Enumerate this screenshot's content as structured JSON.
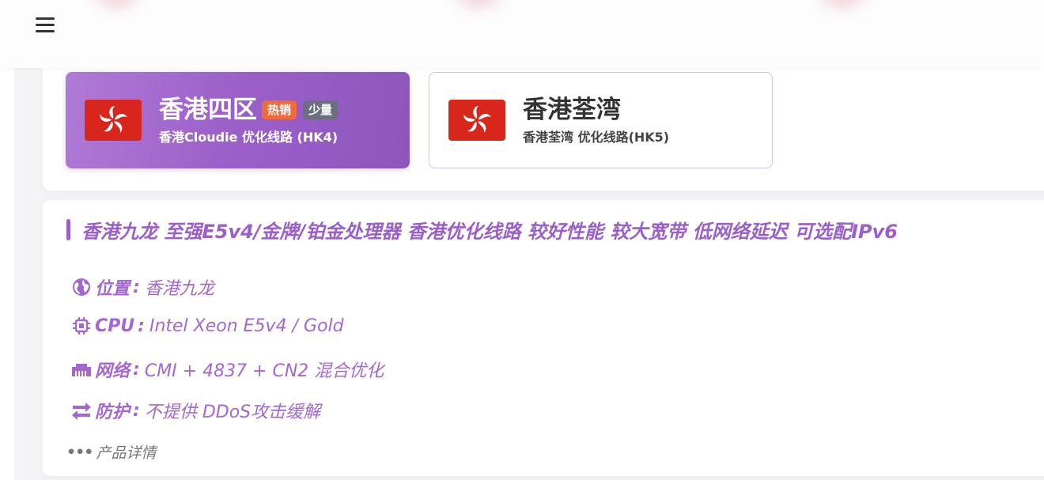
{
  "header": {
    "menu_icon": "hamburger-menu-icon"
  },
  "regions": [
    {
      "title": "香港四区",
      "subtitle": "香港Cloudie 优化线路 (HK4)",
      "badges": [
        "热销",
        "少量"
      ],
      "active": true,
      "flag_icon": "hong-kong-flag-icon"
    },
    {
      "title": "香港荃湾",
      "subtitle": "香港荃湾 优化线路(HK5)",
      "badges": [],
      "active": false,
      "flag_icon": "hong-kong-flag-icon"
    }
  ],
  "product": {
    "title": "香港九龙 至强E5v4/金牌/铂金处理器 香港优化线路 较好性能 较大宽带 低网络延迟 可选配IPv6",
    "specs": [
      {
        "icon": "globe-icon",
        "label": "位置",
        "sep": ":",
        "value": "香港九龙"
      },
      {
        "icon": "cpu-chip-icon",
        "label": "CPU",
        "sep": ":",
        "value": "Intel Xeon E5v4 / Gold"
      },
      {
        "icon": "ethernet-icon",
        "label": "网络",
        "sep": ":",
        "value": "CMI + 4837 + CN2 混合优化"
      },
      {
        "icon": "exchange-arrows-icon",
        "label": "防护",
        "sep": ":",
        "value": "不提供 DDoS攻击缓解"
      }
    ],
    "more_dots": "•••",
    "more_label": "产品详情"
  },
  "colors": {
    "accent": "#9b5fc9",
    "spec_text": "#a467cf",
    "hot_badge": "#f06a3a",
    "few_badge": "#6c6f7e",
    "flag_red": "#d9261c"
  }
}
